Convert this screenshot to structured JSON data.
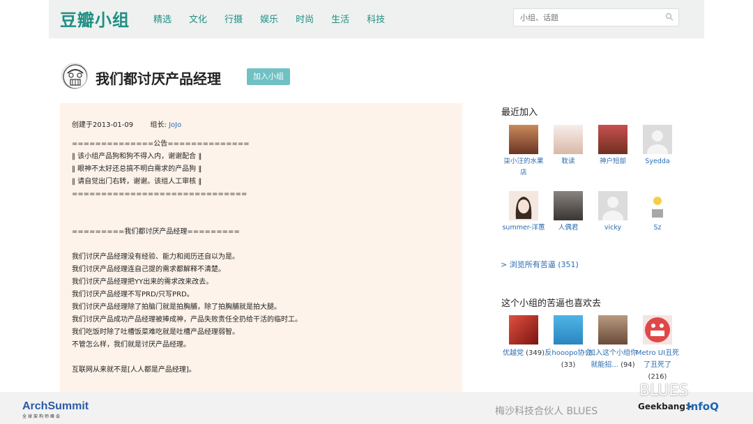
{
  "header": {
    "logo": "豆瓣小组",
    "nav": [
      "精选",
      "文化",
      "行摄",
      "娱乐",
      "时尚",
      "生活",
      "科技"
    ],
    "search_placeholder": "小组、话题"
  },
  "group": {
    "title": "我们都讨厌产品经理",
    "join_label": "加入小组"
  },
  "intro": {
    "created_label": "创建于2013-01-09",
    "owner_label": "组长:",
    "owner_name": "JoJo",
    "lines": [
      "==============公告==============",
      "‖ 该小组产品狗和狗不得入内，谢谢配合 ‖",
      "‖ 眼神不太好还总搞不明白需求的产品狗 ‖",
      "‖ 请自觉出门右转，谢谢。该组人工审核 ‖",
      "==============================",
      "",
      "",
      "=========我们都讨厌产品经理=========",
      "",
      "我们讨厌产品经理没有经验、能力和阅历还自以为是。",
      "我们讨厌产品经理连自己提的需求都解释不清楚。",
      "我们讨厌产品经理把YY出来的需求改来改去。",
      "我们讨厌产品经理不写PRD/只写PRD。",
      "我们讨厌产品经理除了拍脑门就是拍胸脯，除了拍胸脯就是拍大腿。",
      "我们讨厌产品成功产品经理被捧成神，产品失败责任全扔给干活的临时工。",
      "我们吃饭时除了吐槽饭菜难吃就是吐槽产品经理弱智。",
      "不管怎么样，我们就是讨厌产品经理。",
      "",
      "互联网从来就不是[人人都是产品经理]。"
    ]
  },
  "sidebar": {
    "recent_title": "最近加入",
    "members": [
      {
        "name": "柒小汪的水果店",
        "color": "#8a4a3a"
      },
      {
        "name": "耽读",
        "color": "#e9d8d0"
      },
      {
        "name": "神户短部",
        "color": "#b04040"
      },
      {
        "name": "Syedda",
        "color": "#d8d8d8"
      },
      {
        "name": "summer-洋蕙",
        "color": "#f1e4dc"
      },
      {
        "name": "人偶君",
        "color": "#6b6560"
      },
      {
        "name": "vicky",
        "color": "#d8d8d8"
      },
      {
        "name": "Sz",
        "color": "#f5e9a0"
      }
    ],
    "browse_all": "> 浏览所有苦逼 (351)",
    "related_title": "这个小组的苦逼也喜欢去",
    "related": [
      {
        "name": "优越党",
        "count": "(349)",
        "color": "#c0392b"
      },
      {
        "name": "反hooopo协会",
        "count": "(33)",
        "color": "#3aa0d8"
      },
      {
        "name": "加入这个小组你就能招...",
        "count": "(94)",
        "color": "#9a7560"
      },
      {
        "name": "Metro UI丑死了丑死了",
        "count": "(216)",
        "color": "#d84848"
      }
    ]
  },
  "footer": {
    "archsummit": "ArchSummit",
    "archsummit_sub": "全球架构师峰会",
    "partner": "梅沙科技合伙人 BLUES",
    "watermark": "BLUES",
    "geekbang": "Geekbang>",
    "infoq": "InfoQ"
  }
}
